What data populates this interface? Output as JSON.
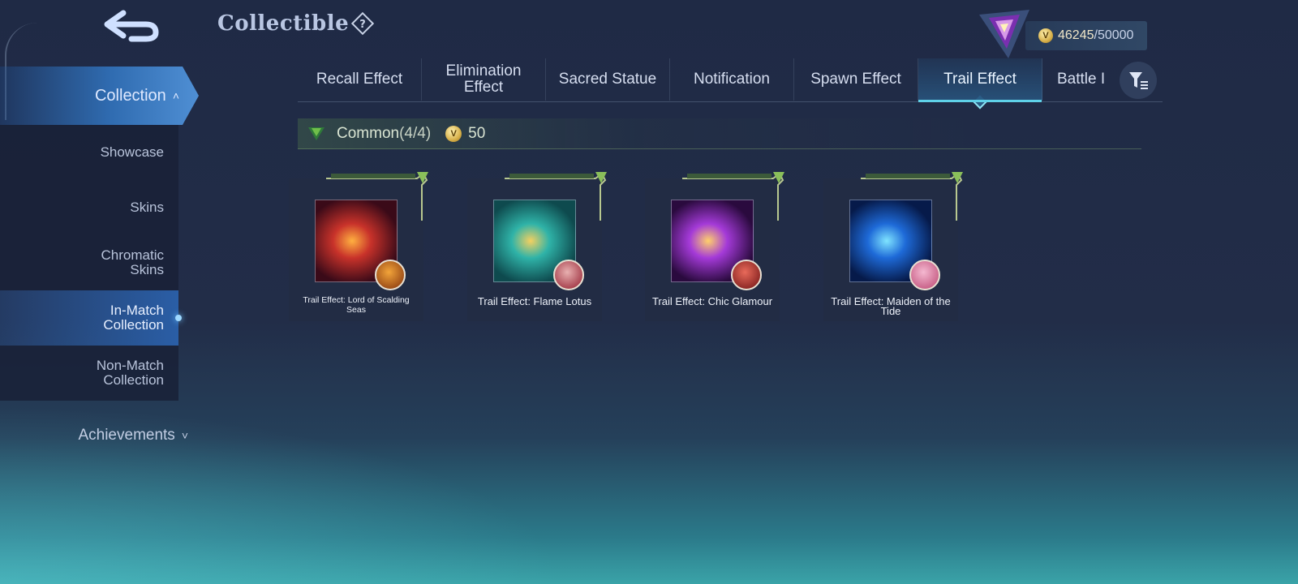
{
  "header": {
    "title": "Collectible",
    "help_icon": "question-diamond-icon",
    "back_icon": "back-arrow-icon"
  },
  "currency": {
    "coin_icon": "collection-point-coin-icon",
    "current": "46245",
    "max": "/50000",
    "rank_emblem_icon": "purple-rank-emblem-icon"
  },
  "sidebar": {
    "collection_label": "Collection",
    "items": [
      {
        "label": "Showcase",
        "active": false
      },
      {
        "label": "Skins",
        "active": false
      },
      {
        "label": "Chromatic Skins",
        "active": false
      },
      {
        "label": "In-Match Collection",
        "active": true
      },
      {
        "label": "Non-Match Collection",
        "active": false
      }
    ],
    "achievements_label": "Achievements"
  },
  "tabs": [
    {
      "label": "Recall Effect",
      "active": false
    },
    {
      "label": "Elimination Effect",
      "active": false
    },
    {
      "label": "Sacred Statue",
      "active": false
    },
    {
      "label": "Notification",
      "active": false
    },
    {
      "label": "Spawn Effect",
      "active": false
    },
    {
      "label": "Trail Effect",
      "active": true
    },
    {
      "label": "Battle I",
      "active": false
    }
  ],
  "filter_icon": "filter-icon",
  "section": {
    "rarity": "Common",
    "count": "(4/4)",
    "points": "50",
    "rarity_icon": "green-gem-icon"
  },
  "cards": [
    {
      "label": "Trail Effect: Lord of Scalding Seas",
      "art_colors": [
        "#3a0a18",
        "#c8322a",
        "#ffb040"
      ],
      "avatar_colors": [
        "#f2a43a",
        "#8a3a10"
      ]
    },
    {
      "label": "Trail Effect: Flame Lotus",
      "art_colors": [
        "#0e4a4e",
        "#2fb3a8",
        "#f4d060"
      ],
      "avatar_colors": [
        "#e8b0b0",
        "#9a2a3a"
      ]
    },
    {
      "label": "Trail Effect: Chic Glamour",
      "art_colors": [
        "#2a0a3e",
        "#a43ad8",
        "#ffd06a"
      ],
      "avatar_colors": [
        "#e86a5a",
        "#7a1a1a"
      ]
    },
    {
      "label": "Trail Effect: Maiden of the Tide",
      "art_colors": [
        "#061a4a",
        "#1e6ad8",
        "#7fe4ff"
      ],
      "avatar_colors": [
        "#f4b8d0",
        "#c0507a"
      ]
    }
  ],
  "colors": {
    "accent_tab": "#5fd1e8",
    "sidebar_active": "#2f6bb0",
    "common_green": "#6fbf4a"
  }
}
